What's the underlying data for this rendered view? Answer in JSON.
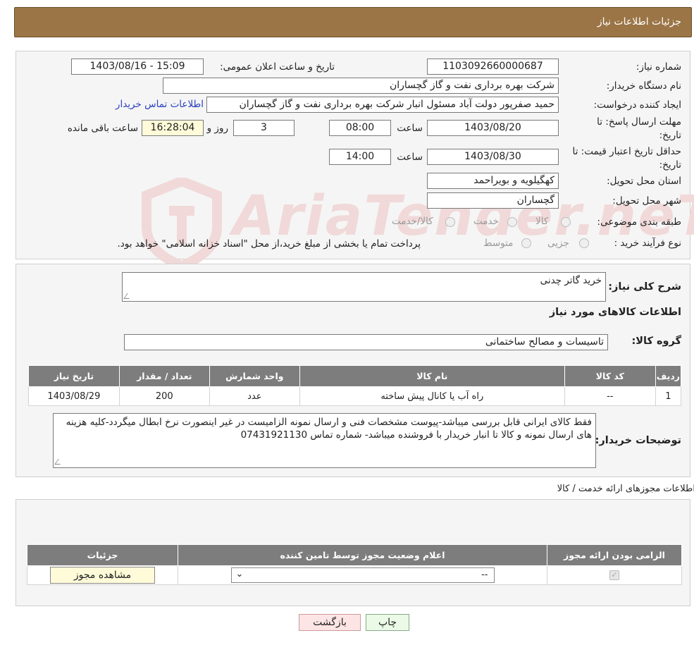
{
  "header": {
    "title": "جزئیات اطلاعات نیاز"
  },
  "watermark": "AriaTender.neT",
  "form": {
    "need_number_label": "شماره نیاز:",
    "need_number": "1103092660000687",
    "announce_label": "تاریخ و ساعت اعلان عمومی:",
    "announce_value": "1403/08/16 - 15:09",
    "buyer_org_label": "نام دستگاه خریدار:",
    "buyer_org": "شرکت بهره برداری نفت و گاز گچساران",
    "creator_label": "ایجاد کننده درخواست:",
    "creator": "حمید  صفرپور دولت آباد مسئول انبار شرکت بهره برداری نفت و گاز گچساران",
    "contact_link": "اطلاعات تماس خریدار",
    "deadline_label": "مهلت ارسال پاسخ: تا تاریخ:",
    "deadline_date": "1403/08/20",
    "time_label": "ساعت",
    "deadline_time": "08:00",
    "days_value": "3",
    "days_label": "روز و",
    "remaining_time": "16:28:04",
    "remaining_label": "ساعت باقی مانده",
    "validity_label": "حداقل تاریخ اعتبار قیمت: تا تاریخ:",
    "validity_date": "1403/08/30",
    "validity_time": "14:00",
    "province_label": "استان محل تحویل:",
    "province": "کهگیلویه و بویراحمد",
    "city_label": "شهر محل تحویل:",
    "city": "گچساران",
    "category_label": "طبقه بندی موضوعی:",
    "category_options": [
      "کالا",
      "خدمت",
      "کالا/خدمت"
    ],
    "process_label": "نوع فرآیند خرید :",
    "process_options": [
      "جزیی",
      "متوسط"
    ],
    "process_note": "پرداخت تمام یا بخشی از مبلغ خرید،از محل \"اسناد خزانه اسلامی\" خواهد بود."
  },
  "summary": {
    "desc_label": "شرح کلی نیاز:",
    "desc": "خرید گاتر چدنی",
    "goods_title": "اطلاعات کالاهای مورد نیاز",
    "group_label": "گروه کالا:",
    "group": "تاسیسات و مصالح ساختمانی",
    "table": {
      "headers": [
        "ردیف",
        "کد کالا",
        "نام کالا",
        "واحد شمارش",
        "تعداد / مقدار",
        "تاریخ نیاز"
      ],
      "rows": [
        [
          "1",
          "--",
          "راه آب یا کانال پیش ساخته",
          "عدد",
          "200",
          "1403/08/29"
        ]
      ]
    },
    "buyer_notes_label": "توضیحات خریدار:",
    "buyer_notes": "فقط کالای ایرانی قابل بررسی میباشد-پیوست مشخصات فنی و ارسال نمونه الزامیست در غیر اینصورت نرخ ابطال میگردد-کلیه هزینه های ارسال نمونه و  کالا  تا انبار خریدار با فروشنده میباشد- شماره تماس 07431921130"
  },
  "permits": {
    "title": "اطلاعات مجوزهای ارائه خدمت / کالا",
    "headers": [
      "الزامی بودن ارائه مجوز",
      "اعلام وضعیت مجوز توسط تامین کننده",
      "جزئیات"
    ],
    "select_value": "--",
    "view_button": "مشاهده مجوز"
  },
  "footer": {
    "print_button": "چاپ",
    "back_button": "بازگشت"
  }
}
